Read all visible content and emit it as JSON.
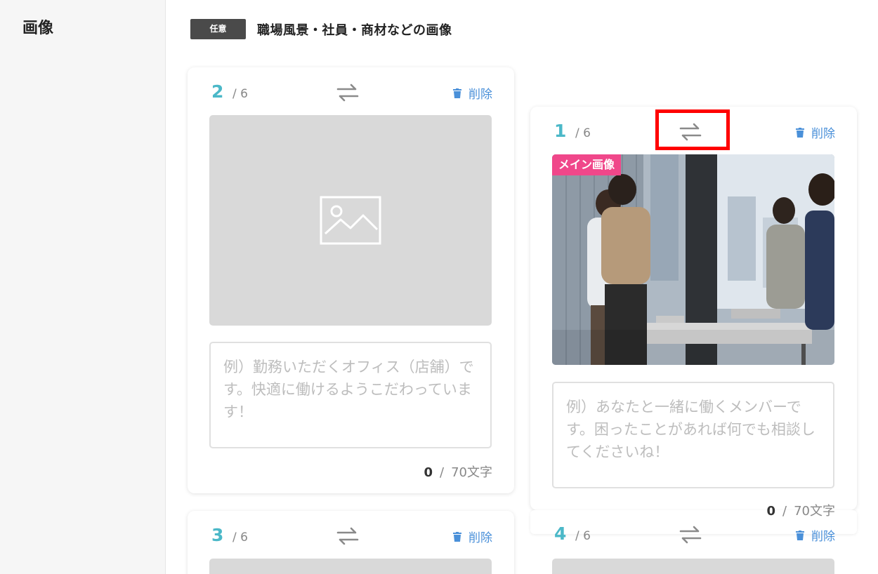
{
  "sidebar": {
    "title": "画像"
  },
  "section": {
    "badge": "任意",
    "title": "職場風景・社員・商材などの画像"
  },
  "cards": [
    {
      "number": "2",
      "total": "/ 6",
      "delete_label": "削除",
      "textarea_placeholder": "例）勤務いただくオフィス（店舗）です。快適に働けるようこだわっています！",
      "count_current": "0",
      "count_sep": "/",
      "count_max": "70文字"
    },
    {
      "number": "1",
      "total": "/ 6",
      "delete_label": "削除",
      "main_badge": "メイン画像",
      "textarea_placeholder": "例）あなたと一緒に働くメンバーです。困ったことがあれば何でも相談してくださいね！",
      "count_current": "0",
      "count_sep": "/",
      "count_max": "70文字"
    },
    {
      "number": "3",
      "total": "/ 6",
      "delete_label": "削除"
    },
    {
      "number": "4",
      "total": "/ 6",
      "delete_label": "削除"
    }
  ],
  "colors": {
    "accent_number": "#4bb8c8",
    "delete_link": "#4a90d9",
    "main_badge": "#f0478a",
    "highlight": "#ff0000"
  },
  "icons": [
    "swap-icon",
    "trash-icon",
    "image-placeholder-icon"
  ]
}
